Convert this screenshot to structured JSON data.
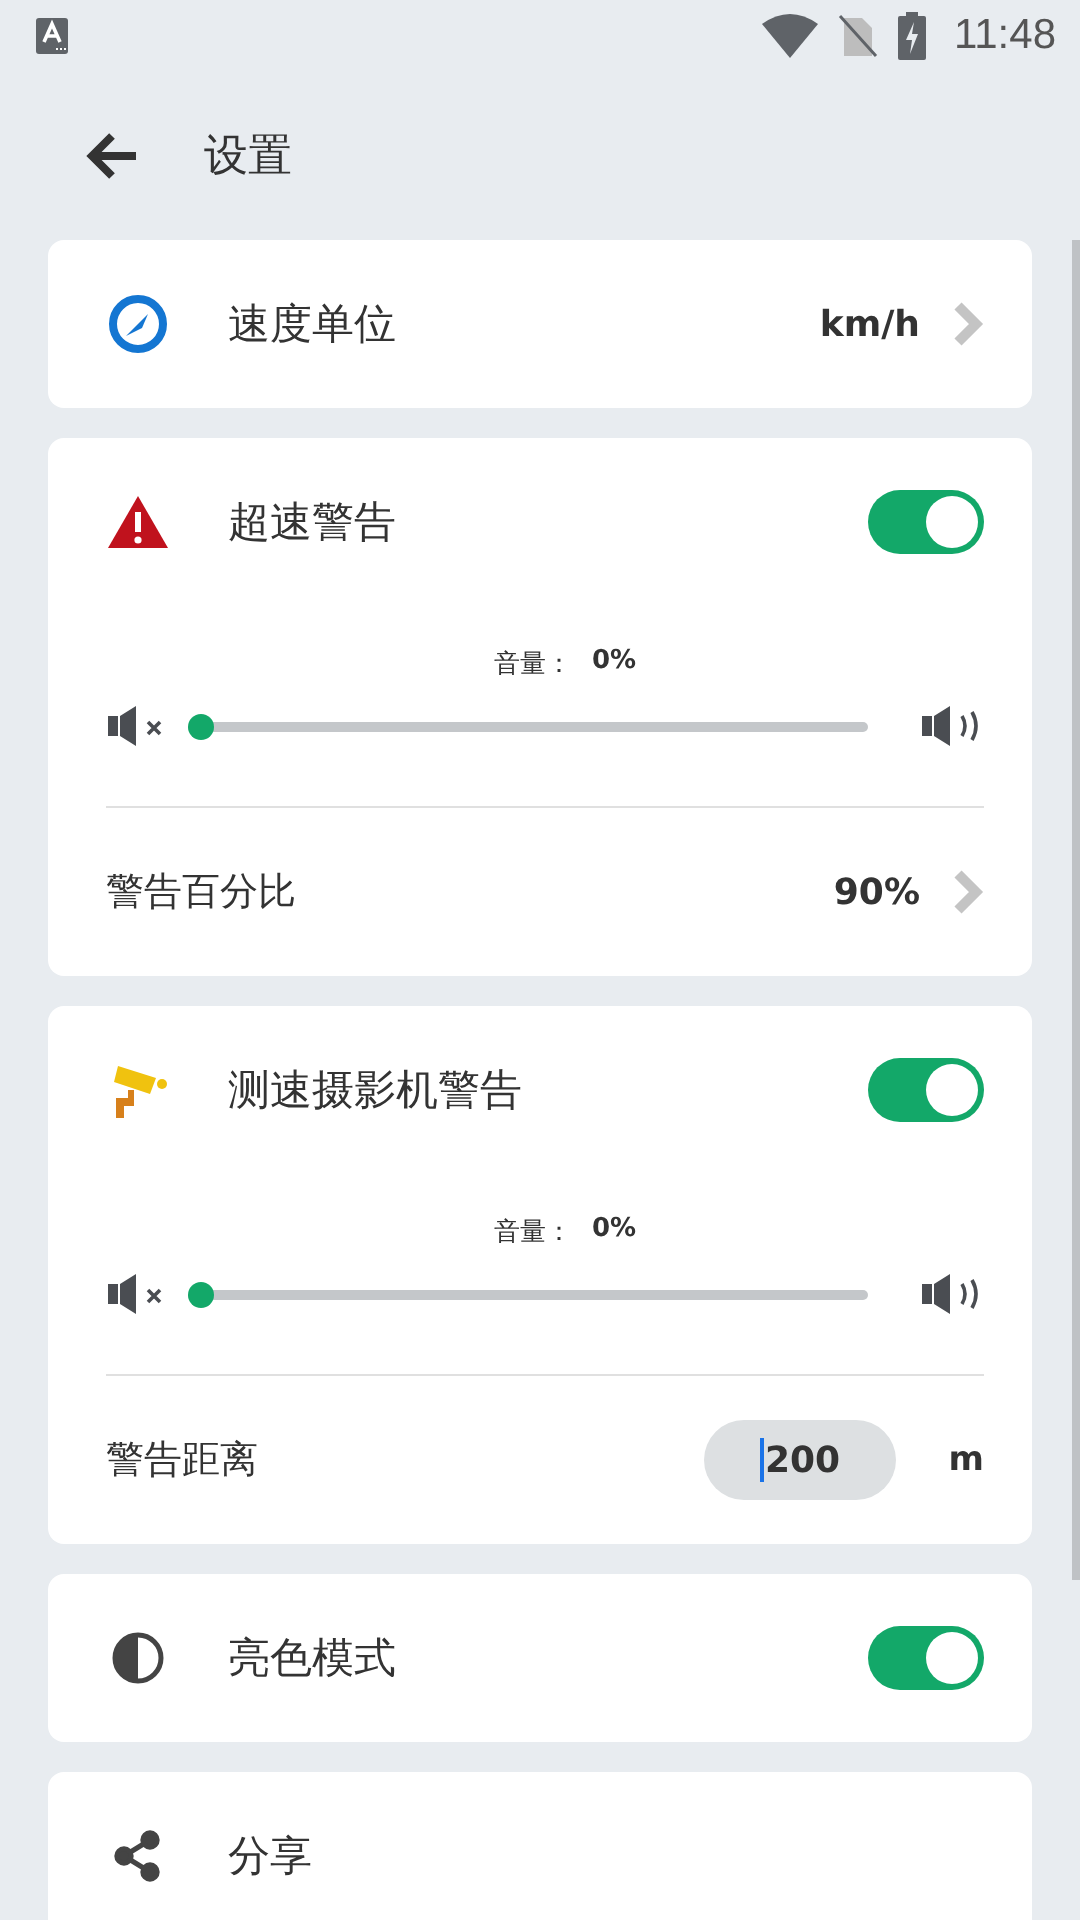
{
  "status_bar": {
    "time": "11:48"
  },
  "toolbar": {
    "title": "设置"
  },
  "cards": [
    {
      "rows": [
        {
          "kind": "link",
          "label": "速度单位",
          "value": "km/h"
        }
      ]
    },
    {
      "rows": [
        {
          "kind": "toggle",
          "label": "超速警告",
          "on": true
        },
        {
          "kind": "volume",
          "label": "音量：",
          "value": "0%",
          "level": 0
        },
        {
          "kind": "link",
          "label": "警告百分比",
          "value": "90%"
        }
      ]
    },
    {
      "rows": [
        {
          "kind": "toggle",
          "label": "测速摄影机警告",
          "on": true
        },
        {
          "kind": "volume",
          "label": "音量：",
          "value": "0%",
          "level": 0
        },
        {
          "kind": "distance",
          "label": "警告距离",
          "value": "200",
          "unit": "m"
        }
      ]
    },
    {
      "rows": [
        {
          "kind": "toggle",
          "label": "亮色模式",
          "on": true
        }
      ]
    },
    {
      "rows": [
        {
          "kind": "plain",
          "label": "分享"
        }
      ]
    }
  ]
}
